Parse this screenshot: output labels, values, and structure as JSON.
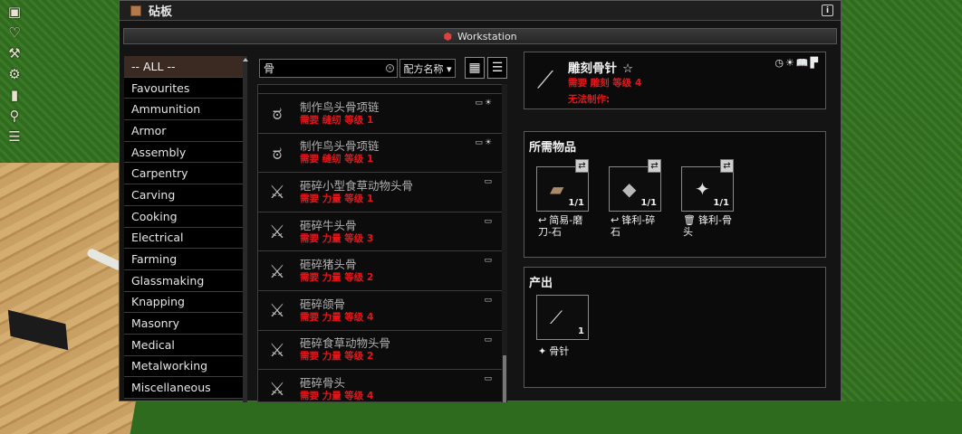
{
  "window": {
    "title": "砧板",
    "info_icon": "info-icon"
  },
  "workstation": {
    "label": "Workstation",
    "icon": "workstation-icon"
  },
  "side_tools": [
    "crate-icon",
    "heart-icon",
    "hammer-icon",
    "craft-icon",
    "lantern-icon",
    "search-icon",
    "stack-icon"
  ],
  "categories": [
    {
      "label": "-- ALL --",
      "selected": true
    },
    {
      "label": "Favourites"
    },
    {
      "label": "Ammunition"
    },
    {
      "label": "Armor"
    },
    {
      "label": "Assembly"
    },
    {
      "label": "Carpentry"
    },
    {
      "label": "Carving"
    },
    {
      "label": "Cooking"
    },
    {
      "label": "Electrical"
    },
    {
      "label": "Farming"
    },
    {
      "label": "Glassmaking"
    },
    {
      "label": "Knapping"
    },
    {
      "label": "Masonry"
    },
    {
      "label": "Medical"
    },
    {
      "label": "Metalworking"
    },
    {
      "label": "Miscellaneous"
    }
  ],
  "search": {
    "value": "骨",
    "sort_label": "配方名称 ▾"
  },
  "recipes": [
    {
      "name": "制作鸟头骨项链",
      "req": "需要 缝纫 等级 1",
      "icon": "necklace-icon",
      "flags": "▭☀"
    },
    {
      "name": "制作鸟头骨项链",
      "req": "需要 缝纫 等级 1",
      "icon": "necklace-icon",
      "flags": "▭☀"
    },
    {
      "name": "砸碎小型食草动物头骨",
      "req": "需要 力量 等级 1",
      "icon": "bone-icon",
      "flags": "▭"
    },
    {
      "name": "砸碎牛头骨",
      "req": "需要 力量 等级 3",
      "icon": "bone-icon",
      "flags": "▭"
    },
    {
      "name": "砸碎猪头骨",
      "req": "需要 力量 等级 2",
      "icon": "bone-icon",
      "flags": "▭"
    },
    {
      "name": "砸碎颌骨",
      "req": "需要 力量 等级 4",
      "icon": "bone-icon",
      "flags": "▭"
    },
    {
      "name": "砸碎食草动物头骨",
      "req": "需要 力量 等级 2",
      "icon": "bone-icon",
      "flags": "▭"
    },
    {
      "name": "砸碎骨头",
      "req": "需要 力量 等级 4",
      "icon": "bone-icon",
      "flags": "▭"
    }
  ],
  "detail": {
    "name": "雕刻骨针",
    "requirement": "需要 雕刻 等级 4",
    "status": "无法制作:",
    "corner_icons": "◷☀📖▛"
  },
  "needed": {
    "title": "所需物品",
    "items": [
      {
        "qty": "1/1",
        "label": "简易-磨刀-石",
        "label_icon": "↩",
        "img": "▰"
      },
      {
        "qty": "1/1",
        "label": "锋利-碎石",
        "label_icon": "↩",
        "img": "◆"
      },
      {
        "qty": "1/1",
        "label": "锋利-骨头",
        "label_icon": "🗑",
        "img": "✦"
      }
    ]
  },
  "output": {
    "title": "产出",
    "qty": "1",
    "label": "骨针",
    "label_icon": "✦"
  }
}
